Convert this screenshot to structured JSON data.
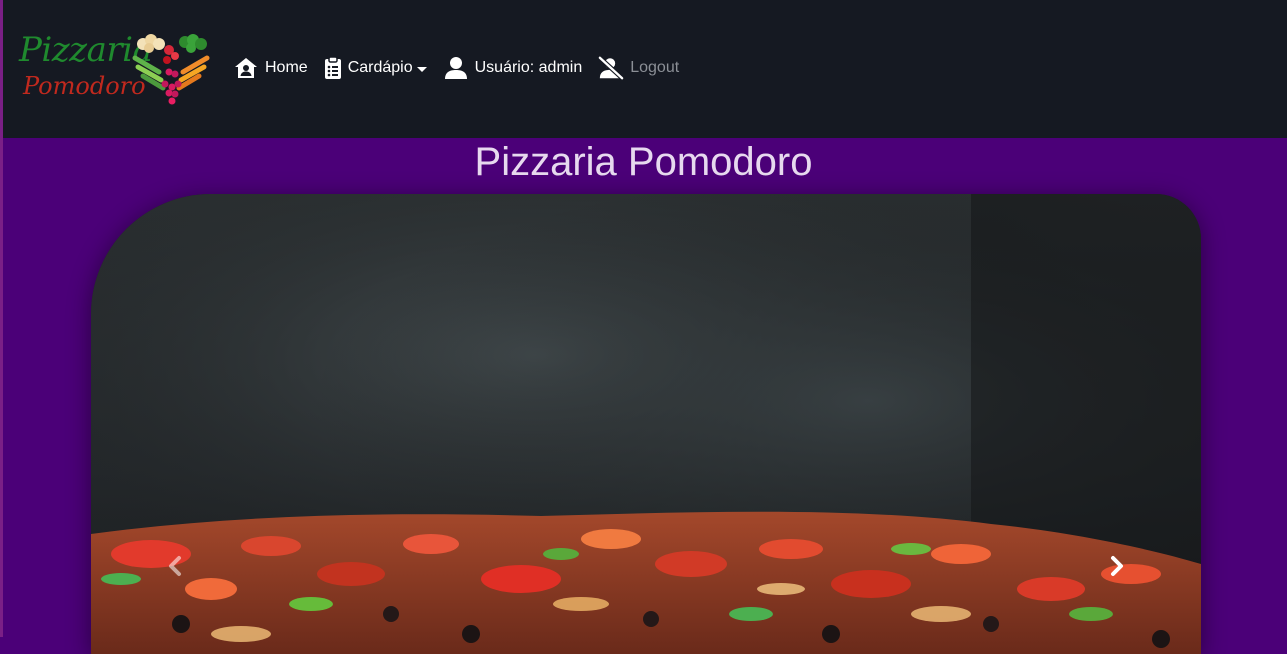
{
  "brand": {
    "line1": "Pizzaria",
    "line2": "Pomodoro",
    "logo_icon": "heart-of-vegetables-icon"
  },
  "nav": {
    "home": {
      "label": "Home",
      "icon": "home-user-icon"
    },
    "cardapio": {
      "label": "Cardápio",
      "icon": "clipboard-list-icon"
    },
    "user": {
      "label": "Usuário: admin",
      "icon": "user-icon"
    },
    "logout": {
      "label": "Logout",
      "icon": "user-slash-icon"
    }
  },
  "main": {
    "title": "Pizzaria Pomodoro",
    "carousel": {
      "image": "pizza-with-smoke-photo",
      "prev_icon": "chevron-left-icon",
      "next_icon": "chevron-right-icon"
    }
  },
  "colors": {
    "navbar_bg": "#151922",
    "page_bg": "#4b0078",
    "title_color": "#e7d9ef",
    "logout_color": "#8b8f96"
  }
}
